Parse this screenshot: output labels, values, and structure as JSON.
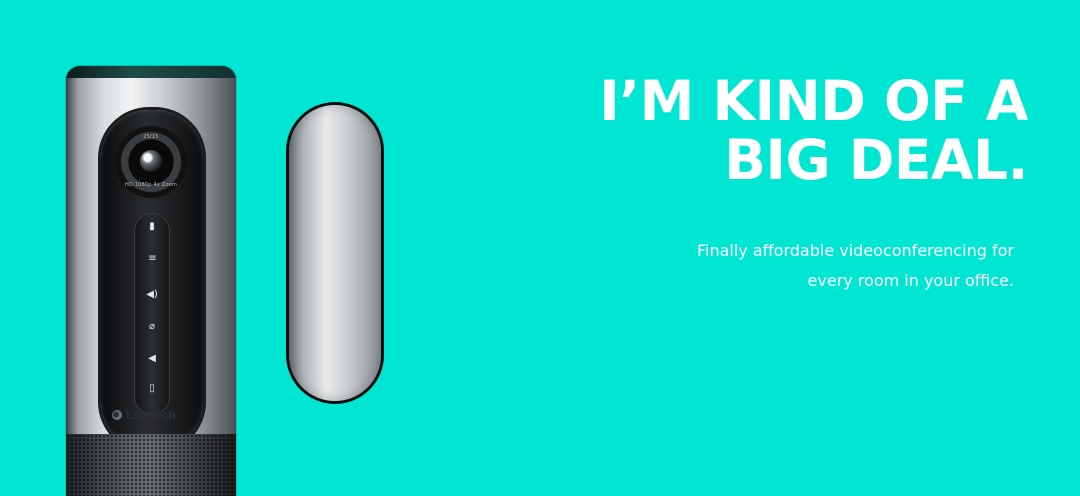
{
  "banner": {
    "background_color": "#00e6d2",
    "headline": {
      "line1": "I’M KIND OF A",
      "line2": "BIG DEAL."
    },
    "subtext": {
      "line1": "Finally affordable videoconferencing for",
      "line2": "every room in your office."
    },
    "product": {
      "camera": {
        "lens_text_top": "25/15",
        "lens_text_bottom": "HD 1080p 4x Zoom",
        "logo_text": "Logitech",
        "icons": [
          "camera-icon",
          "volume-up-icon",
          "mute-mic-icon",
          "volume-down-icon"
        ]
      }
    }
  }
}
